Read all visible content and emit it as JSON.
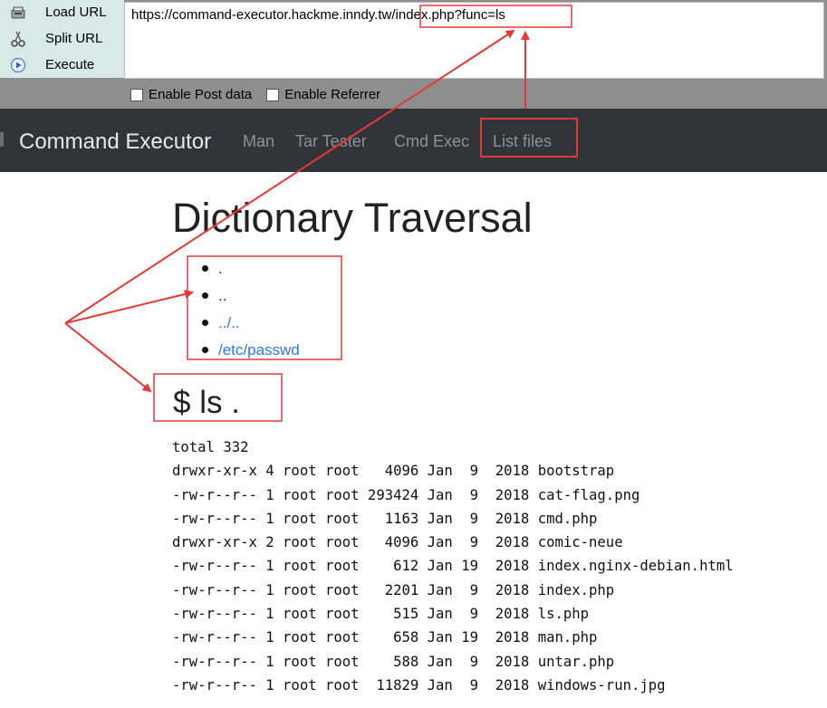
{
  "hackbar": {
    "buttons": [
      {
        "label": "Load URL",
        "icon": "load-url-icon"
      },
      {
        "label": "Split URL",
        "icon": "split-url-icon"
      },
      {
        "label": "Execute",
        "icon": "execute-icon"
      }
    ],
    "url": "https://command-executor.hackme.inndy.tw/index.php?func=ls",
    "options": [
      {
        "label": "Enable Post data",
        "checked": false
      },
      {
        "label": "Enable Referrer",
        "checked": false
      }
    ]
  },
  "navbar": {
    "brand": "Command Executor",
    "links": [
      "Man",
      "Tar Tester",
      "Cmd Exec",
      "List files"
    ]
  },
  "page": {
    "title": "Dictionary Traversal",
    "entries": [
      {
        "text": ".",
        "link": false
      },
      {
        "text": "..",
        "link": false
      },
      {
        "text": "../..",
        "link": true
      },
      {
        "text": "/etc/passwd",
        "link": true
      }
    ],
    "command": "$ ls .",
    "output": [
      "total 332",
      "drwxr-xr-x 4 root root   4096 Jan  9  2018 bootstrap",
      "-rw-r--r-- 1 root root 293424 Jan  9  2018 cat-flag.png",
      "-rw-r--r-- 1 root root   1163 Jan  9  2018 cmd.php",
      "drwxr-xr-x 2 root root   4096 Jan  9  2018 comic-neue",
      "-rw-r--r-- 1 root root    612 Jan 19  2018 index.nginx-debian.html",
      "-rw-r--r-- 1 root root   2201 Jan  9  2018 index.php",
      "-rw-r--r-- 1 root root    515 Jan  9  2018 ls.php",
      "-rw-r--r-- 1 root root    658 Jan 19  2018 man.php",
      "-rw-r--r-- 1 root root    588 Jan  9  2018 untar.php",
      "-rw-r--r-- 1 root root  11829 Jan  9  2018 windows-run.jpg"
    ]
  },
  "colors": {
    "annotation": "#e53935",
    "navbar_bg": "#31353a",
    "link": "#2a7ae2"
  }
}
